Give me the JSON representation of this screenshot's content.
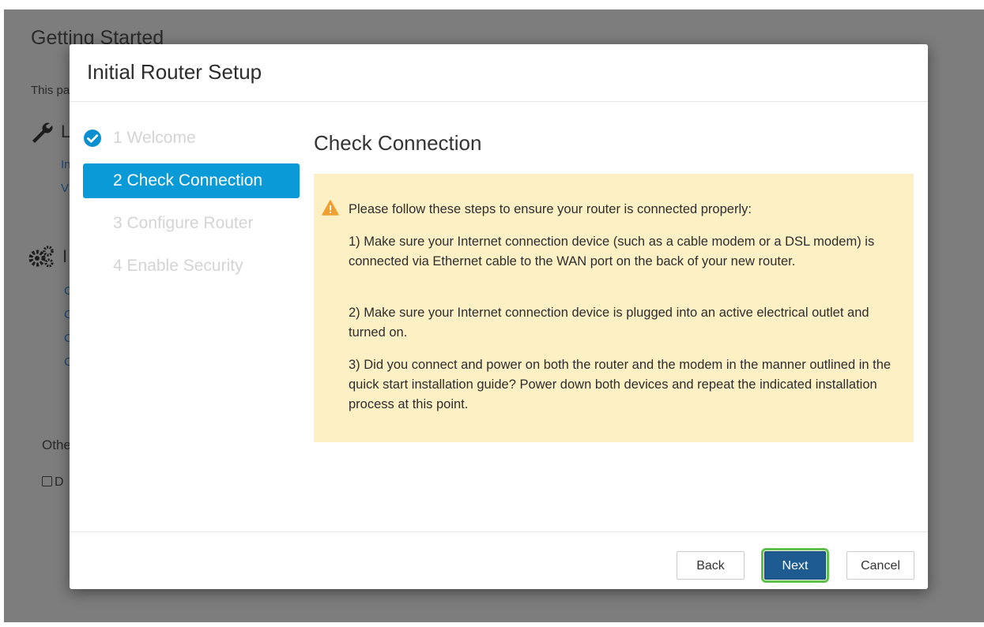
{
  "background": {
    "title": "Getting Started",
    "description": "This pa",
    "section1": {
      "heading": "L",
      "links": [
        "In",
        "V"
      ]
    },
    "section2": {
      "heading": "I",
      "links": [
        "C",
        "C",
        "C",
        "C"
      ]
    },
    "other_label": "Othe",
    "checkbox_label": "D"
  },
  "modal": {
    "title": "Initial Router Setup",
    "steps": [
      {
        "label": "1 Welcome",
        "state": "completed"
      },
      {
        "label": "2 Check Connection",
        "state": "active"
      },
      {
        "label": "3 Configure Router",
        "state": "pending"
      },
      {
        "label": "4 Enable Security",
        "state": "pending"
      }
    ],
    "content_title": "Check Connection",
    "alert": {
      "intro": "Please follow these steps to ensure your router is connected properly:",
      "items": [
        "1) Make sure your Internet connection device (such as a cable modem or a DSL modem) is connected via Ethernet cable to the WAN port on the back of your new router.",
        "2) Make sure your Internet connection device is plugged into an active electrical outlet and turned on.",
        "3) Did you connect and power on both the router and the modem in the manner outlined in the quick start installation guide? Power down both devices and repeat the indicated installation process at this point."
      ]
    },
    "buttons": {
      "back": "Back",
      "next": "Next",
      "cancel": "Cancel"
    }
  },
  "colors": {
    "active_step": "#0a9ad8",
    "alert_background": "#fdf0c4",
    "next_button": "#1e5b91",
    "highlight_ring": "#5fc04c",
    "warning_icon": "#f0a030"
  },
  "icons": [
    "wrench-icon",
    "gears-icon",
    "check-circle-icon",
    "warning-icon"
  ]
}
